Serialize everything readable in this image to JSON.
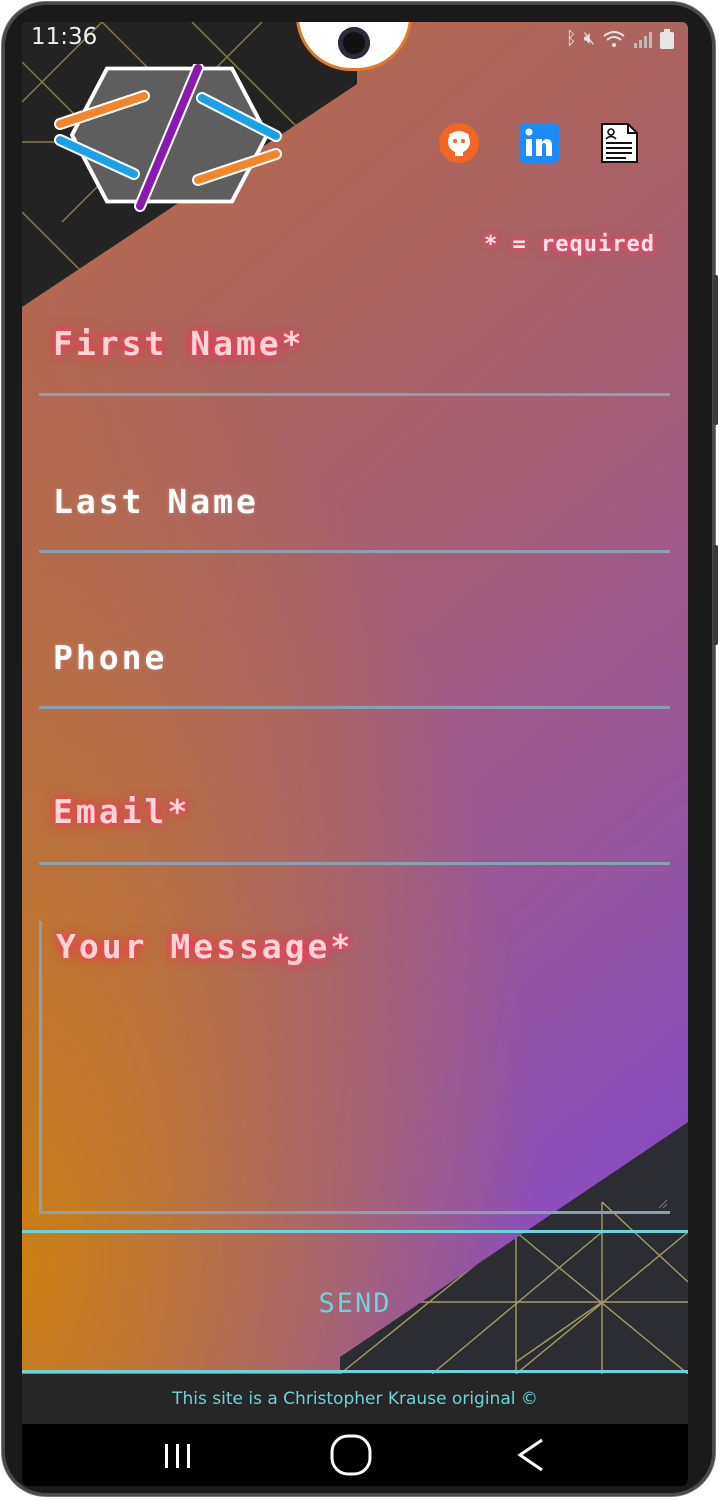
{
  "status_bar": {
    "time": "11:36",
    "icons": [
      "bluetooth-icon",
      "mute-icon",
      "wifi-icon",
      "signal-icon",
      "battery-icon"
    ]
  },
  "header": {
    "logo_name": "code-brackets-logo",
    "social_links": [
      {
        "name": "github-icon",
        "color": "#f26522"
      },
      {
        "name": "linkedin-icon",
        "color": "#1d8cf8"
      },
      {
        "name": "resume-icon",
        "color": "#ffffff"
      }
    ]
  },
  "form": {
    "required_note": "* = required",
    "fields": {
      "first_name": "First Name*",
      "last_name": "Last Name",
      "phone": "Phone",
      "email": "Email*",
      "message": "Your Message*"
    },
    "send_label": "SEND"
  },
  "footer": {
    "text": "This site is a Christopher Krause original ©"
  },
  "colors": {
    "accent_cyan": "#6dd3da",
    "required_glow": "#ff3d5e",
    "underline": "#8aa0b0"
  }
}
